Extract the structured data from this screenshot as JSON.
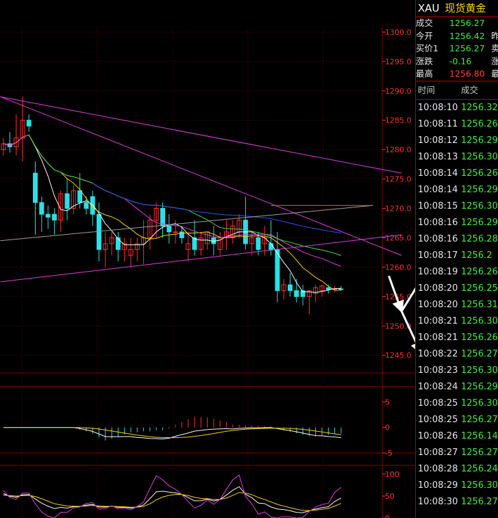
{
  "header": {
    "symbol": "XAU",
    "name": "现货黄金"
  },
  "quote": [
    {
      "label": "成交",
      "value": "1256.27",
      "color": "#3cf03c",
      "label2": ""
    },
    {
      "label": "今开",
      "value": "1256.42",
      "color": "#3cf03c",
      "label2": "昨"
    },
    {
      "label": "买价1",
      "value": "1256.27",
      "color": "#3cf03c",
      "label2": "卖"
    },
    {
      "label": "涨跌",
      "value": "-0.16",
      "color": "#3cf03c",
      "label2": "涨"
    },
    {
      "label": "最高",
      "value": "1256.80",
      "color": "#ff4040",
      "label2": "最"
    }
  ],
  "ticks_header": {
    "time": "时间",
    "price": "成交"
  },
  "ticks": [
    {
      "time": "10:08:10",
      "price": "1256.32"
    },
    {
      "time": "10:08:11",
      "price": "1256.26"
    },
    {
      "time": "10:08:12",
      "price": "1256.29"
    },
    {
      "time": "10:08:13",
      "price": "1256.30"
    },
    {
      "time": "10:08:14",
      "price": "1256.26"
    },
    {
      "time": "10:08:14",
      "price": "1256.29"
    },
    {
      "time": "10:08:15",
      "price": "1256.30"
    },
    {
      "time": "10:08:16",
      "price": "1256.29"
    },
    {
      "time": "10:08:16",
      "price": "1256.28"
    },
    {
      "time": "10:08:17",
      "price": "1256.2"
    },
    {
      "time": "10:08:19",
      "price": "1256.26"
    },
    {
      "time": "10:08:20",
      "price": "1256.25"
    },
    {
      "time": "10:08:20",
      "price": "1256.31"
    },
    {
      "time": "10:08:21",
      "price": "1256.30"
    },
    {
      "time": "10:08:21",
      "price": "1256.26"
    },
    {
      "time": "10:08:22",
      "price": "1256.27"
    },
    {
      "time": "10:08:23",
      "price": "1256.30"
    },
    {
      "time": "10:08:24",
      "price": "1256.29"
    },
    {
      "time": "10:08:25",
      "price": "1256.30"
    },
    {
      "time": "10:08:25",
      "price": "1256.27"
    },
    {
      "time": "10:08:26",
      "price": "1256.14"
    },
    {
      "time": "10:08:27",
      "price": "1256.27"
    },
    {
      "time": "10:08:28",
      "price": "1256.24"
    },
    {
      "time": "10:08:29",
      "price": "1256.30"
    },
    {
      "time": "10:08:30",
      "price": "1256.27"
    }
  ],
  "colors": {
    "up": "#ff3030",
    "down": "#28e0e8",
    "grid": "#8b0000",
    "axis_text": "#ff3030"
  },
  "chart_data": [
    {
      "type": "candlestick",
      "panel": "price",
      "ylim": [
        1242,
        1300.8
      ],
      "y_ticks": [
        "1300.0",
        "1295.0",
        "1290.0",
        "1285.0",
        "1280.0",
        "1275.0",
        "1270.0",
        "1265.0",
        "1260.0",
        "1255.0",
        "1250.0",
        "1245.0"
      ],
      "candles": [
        [
          1280,
          1282,
          1279,
          1281
        ],
        [
          1281,
          1283,
          1279.5,
          1280.5
        ],
        [
          1280.5,
          1286,
          1279,
          1282
        ],
        [
          1282,
          1289,
          1278,
          1285
        ],
        [
          1285,
          1286,
          1283,
          1284
        ],
        [
          1276,
          1278,
          1265.5,
          1271
        ],
        [
          1271,
          1272,
          1266,
          1269
        ],
        [
          1269,
          1270.5,
          1266.5,
          1268.5
        ],
        [
          1269,
          1270,
          1265.5,
          1268
        ],
        [
          1268,
          1273,
          1266,
          1272.5
        ],
        [
          1272.5,
          1275,
          1268,
          1270
        ],
        [
          1270,
          1274,
          1269,
          1273
        ],
        [
          1273,
          1276,
          1270,
          1271
        ],
        [
          1271,
          1272,
          1269,
          1270
        ],
        [
          1272,
          1273,
          1267,
          1269
        ],
        [
          1269,
          1271,
          1261,
          1263
        ],
        [
          1263,
          1266,
          1260,
          1264
        ],
        [
          1264,
          1266,
          1262,
          1265
        ],
        [
          1265,
          1266,
          1261,
          1263
        ],
        [
          1263,
          1265,
          1261,
          1264
        ],
        [
          1262,
          1265,
          1260,
          1263
        ],
        [
          1263,
          1265,
          1261,
          1264
        ],
        [
          1264,
          1268,
          1260.5,
          1265
        ],
        [
          1265,
          1269,
          1263,
          1268
        ],
        [
          1268,
          1271,
          1265,
          1270
        ],
        [
          1270,
          1271,
          1265,
          1267
        ],
        [
          1267,
          1269,
          1264,
          1266
        ],
        [
          1266,
          1268,
          1264,
          1266
        ],
        [
          1266,
          1267,
          1264,
          1265
        ],
        [
          1263,
          1266,
          1261,
          1264
        ],
        [
          1265,
          1268,
          1262,
          1263
        ],
        [
          1263,
          1266,
          1262,
          1265
        ],
        [
          1264,
          1266,
          1263,
          1266
        ],
        [
          1265,
          1267,
          1262,
          1264
        ],
        [
          1263,
          1266,
          1262,
          1265
        ],
        [
          1265,
          1268,
          1263,
          1266
        ],
        [
          1265,
          1268,
          1264,
          1267
        ],
        [
          1266,
          1269,
          1265,
          1268
        ],
        [
          1268,
          1272,
          1263,
          1264
        ],
        [
          1264,
          1266,
          1262,
          1265
        ],
        [
          1265,
          1266,
          1262,
          1263
        ],
        [
          1264,
          1267,
          1262,
          1265
        ],
        [
          1264,
          1268,
          1262,
          1263
        ],
        [
          1263,
          1266,
          1254,
          1256
        ],
        [
          1256,
          1258,
          1254.5,
          1257
        ],
        [
          1257,
          1259,
          1255,
          1256
        ],
        [
          1256,
          1258,
          1254,
          1255
        ],
        [
          1256,
          1257,
          1253.5,
          1255
        ],
        [
          1255,
          1256,
          1252,
          1256
        ],
        [
          1255.5,
          1257,
          1254,
          1256.5
        ],
        [
          1256,
          1257,
          1255,
          1256.8
        ],
        [
          1256.5,
          1257,
          1255.5,
          1256.2
        ],
        [
          1256.2,
          1256.8,
          1255.8,
          1256.3
        ],
        [
          1256.3,
          1256.8,
          1256,
          1256.27
        ]
      ],
      "trend_lines": [
        {
          "from": [
            -0.5,
            1289
          ],
          "to": [
            62.5,
            1276
          ],
          "color": "#e040e0"
        },
        {
          "from": [
            -0.5,
            1289
          ],
          "to": [
            62.5,
            1262
          ],
          "color": "#e040e0"
        },
        {
          "from": [
            -0.5,
            1257.5
          ],
          "to": [
            62.5,
            1265.5
          ],
          "color": "#e040e0"
        },
        {
          "from": [
            -0.5,
            1264.5
          ],
          "to": [
            58,
            1270.5
          ],
          "color": "#a0a0a0"
        },
        {
          "from": [
            42,
            1270.5
          ],
          "to": [
            58,
            1270.5
          ],
          "color": "#a08060"
        }
      ],
      "projection_arrows": [
        {
          "from": [
            60.5,
            1258.5
          ],
          "to": [
            62.5,
            1252.5
          ]
        },
        {
          "from": [
            62.5,
            1252.5
          ],
          "to": [
            66.5,
            1259.5
          ]
        },
        {
          "from": [
            66.5,
            1259.5
          ],
          "to": [
            69.5,
            1254.5
          ]
        },
        {
          "from": [
            62.5,
            1252.5
          ],
          "to": [
            65.5,
            1245.5
          ]
        },
        {
          "from": [
            65.5,
            1245.5
          ],
          "to": [
            69.5,
            1253.5
          ]
        }
      ]
    },
    {
      "type": "macd",
      "panel": "macd",
      "ylim": [
        -5,
        8
      ],
      "y_ticks": [
        "5",
        "0",
        "-5"
      ]
    },
    {
      "type": "oscillator",
      "panel": "kdj",
      "ylim": [
        0,
        120
      ],
      "y_ticks": [
        "100",
        "50",
        "0"
      ]
    }
  ]
}
